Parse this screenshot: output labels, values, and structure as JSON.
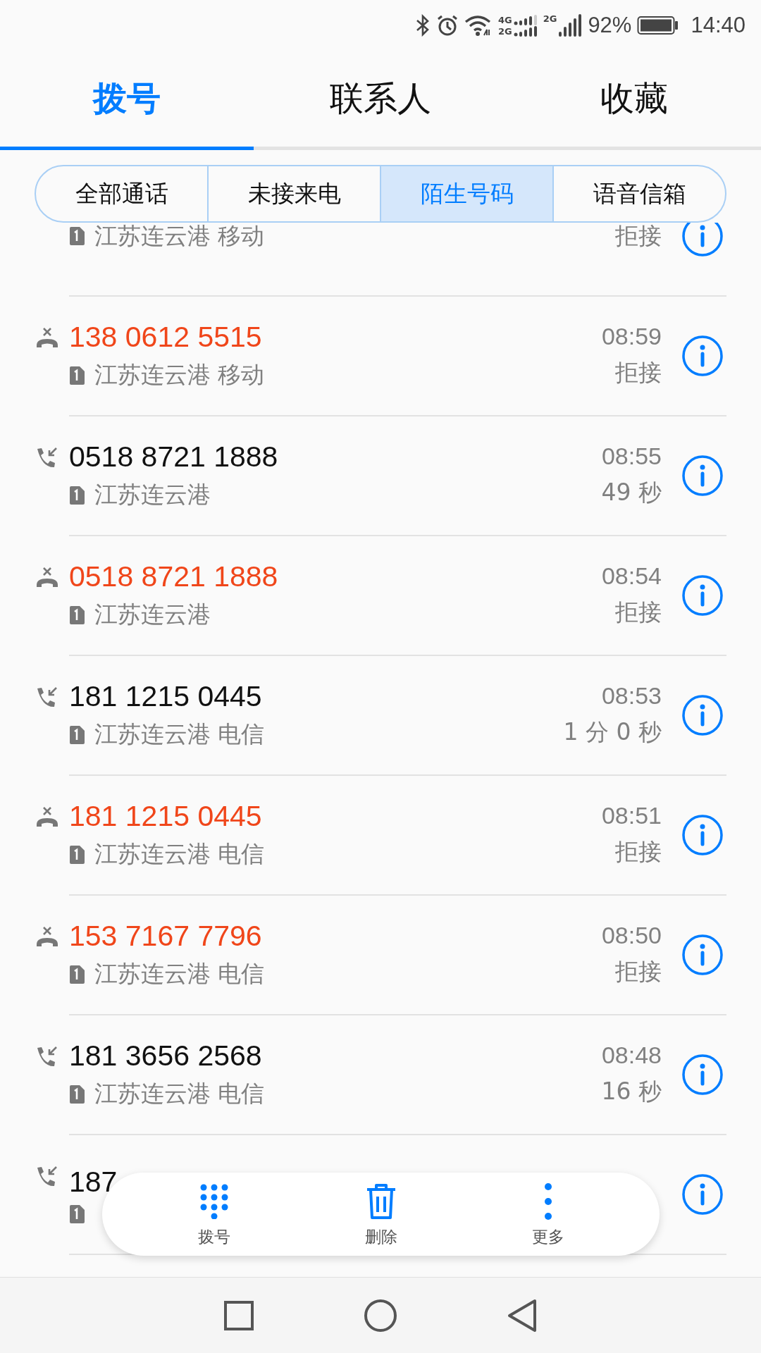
{
  "status_bar": {
    "sim1_labels": [
      "4G",
      "2G"
    ],
    "sim2_label": "2G",
    "battery": "92%",
    "time": "14:40"
  },
  "tabs": [
    {
      "label": "拨号",
      "selected": true
    },
    {
      "label": "联系人",
      "selected": false
    },
    {
      "label": "收藏",
      "selected": false
    }
  ],
  "filters": [
    {
      "label": "全部通话",
      "selected": false
    },
    {
      "label": "未接来电",
      "selected": false
    },
    {
      "label": "陌生号码",
      "selected": true
    },
    {
      "label": "语音信箱",
      "selected": false
    }
  ],
  "calls": [
    {
      "location": "江苏连云港 移动",
      "detail": "拒接"
    },
    {
      "kind": "rejected",
      "number": "138 0612 5515",
      "location": "江苏连云港 移动",
      "time": "08:59",
      "detail": "拒接"
    },
    {
      "kind": "incoming",
      "number": "0518 8721 1888",
      "location": "江苏连云港",
      "time": "08:55",
      "detail": "49 秒"
    },
    {
      "kind": "rejected",
      "number": "0518 8721 1888",
      "location": "江苏连云港",
      "time": "08:54",
      "detail": "拒接"
    },
    {
      "kind": "incoming",
      "number": "181 1215 0445",
      "location": "江苏连云港 电信",
      "time": "08:53",
      "detail": "1 分 0 秒"
    },
    {
      "kind": "rejected",
      "number": "181 1215 0445",
      "location": "江苏连云港 电信",
      "time": "08:51",
      "detail": "拒接"
    },
    {
      "kind": "rejected",
      "number": "153 7167 7796",
      "location": "江苏连云港 电信",
      "time": "08:50",
      "detail": "拒接"
    },
    {
      "kind": "incoming",
      "number": "181 3656 2568",
      "location": "江苏连云港 电信",
      "time": "08:48",
      "detail": "16 秒"
    },
    {
      "kind": "incoming",
      "number": "187"
    }
  ],
  "actions": [
    {
      "kind": "dialpad",
      "label": "拨号"
    },
    {
      "kind": "delete",
      "label": "删除"
    },
    {
      "kind": "more",
      "label": "更多"
    }
  ]
}
